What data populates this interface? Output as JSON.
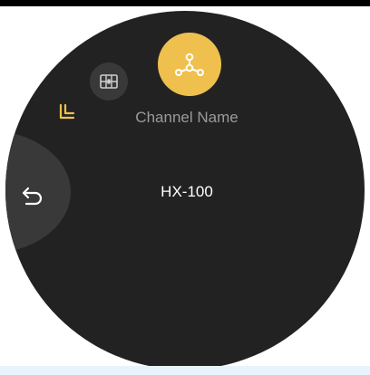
{
  "screen": {
    "channel_label": "Channel Name",
    "channel_value": "HX-100"
  },
  "icons": {
    "back": "undo-arrow-icon",
    "share": "share-network-icon",
    "grid": "grid-panel-icon",
    "collapse": "collapse-corner-icon"
  },
  "colors": {
    "watch_background": "#232223",
    "accent": "#f0c04e",
    "secondary_button": "#3a393a",
    "label": "#9a9a9a",
    "value": "#ffffff"
  }
}
